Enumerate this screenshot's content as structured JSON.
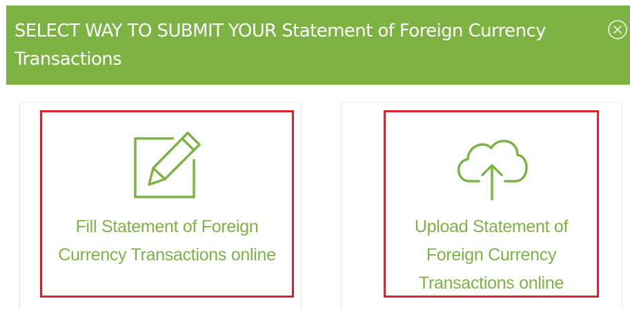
{
  "modal": {
    "title": "SELECT WAY TO SUBMIT YOUR Statement of Foreign Currency Transactions",
    "close_icon": "close-circle-icon"
  },
  "options": [
    {
      "id": "fill",
      "icon": "edit-pencil-icon",
      "label": "Fill Statement of Foreign Currency Transactions online"
    },
    {
      "id": "upload",
      "icon": "cloud-upload-icon",
      "label": "Upload Statement of Foreign Currency Transactions online"
    }
  ],
  "colors": {
    "header_background": "#7cb342",
    "header_text": "#ffffff",
    "accent_green": "#7cb342",
    "highlight_border": "#e0202e",
    "card_border": "#e6e6e6"
  }
}
